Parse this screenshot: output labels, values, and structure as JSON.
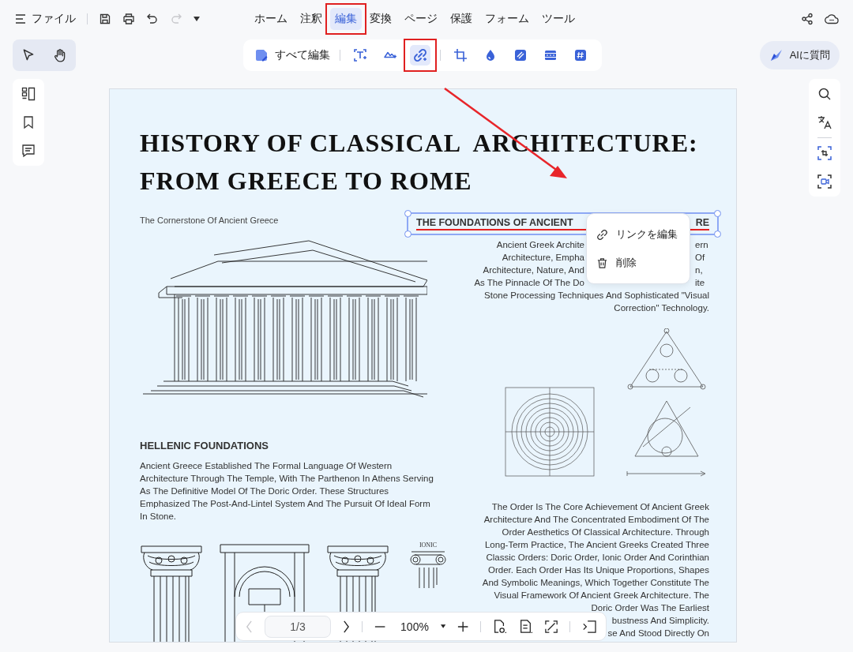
{
  "top_bar": {
    "file_menu": "ファイル",
    "redo_disabled": true
  },
  "menu_tabs": [
    {
      "label": "ホーム",
      "selected": false
    },
    {
      "label": "注釈",
      "selected": false
    },
    {
      "label": "編集",
      "selected": true
    },
    {
      "label": "変換",
      "selected": false
    },
    {
      "label": "ページ",
      "selected": false
    },
    {
      "label": "保護",
      "selected": false
    },
    {
      "label": "フォーム",
      "selected": false
    },
    {
      "label": "ツール",
      "selected": false
    }
  ],
  "edit_toolbar": {
    "edit_all": "すべて編集",
    "tools": [
      {
        "kind": "text",
        "selected": false
      },
      {
        "kind": "image",
        "selected": false
      },
      {
        "kind": "link",
        "selected": true
      },
      {
        "kind": "crop",
        "selected": false
      },
      {
        "kind": "watermark",
        "selected": false
      },
      {
        "kind": "background",
        "selected": false
      },
      {
        "kind": "header-footer",
        "selected": false
      },
      {
        "kind": "bates",
        "selected": false
      }
    ]
  },
  "ai_button": "AIに質問",
  "document": {
    "title_lines": [
      "HISTORY OF CLASSICAL  ARCHITECTURE:",
      "FROM GREECE TO ROME"
    ],
    "subtitle": "The Cornerstone Of Ancient Greece",
    "link_heading": {
      "parts": [
        "THE FOUNDATIONS OF ANCIENT",
        "RE"
      ],
      "selected": true
    },
    "intro_lines": [
      {
        "left": "Ancient Greek Archite",
        "right": "ern"
      },
      {
        "left": "Architecture, Empha",
        "right": "Of"
      },
      {
        "left": "Architecture, Nature, And",
        "right": "n,"
      },
      {
        "left": "As The Pinnacle Of The Do",
        "right": "ite"
      },
      {
        "left": "Stone Processing Techniques And Sophisticated \"Visual"
      },
      {
        "left": "Correction\" Technology."
      }
    ],
    "section_heading": "HELLENIC FOUNDATIONS",
    "section_paragraph": "Ancient Greece Established The Formal Language Of Western Architecture Through The Temple, With The Parthenon In Athens Serving As The Definitive Model Of The Doric Order. These Structures Emphasized The Post-And-Lintel System And The Pursuit Of Ideal Form In Stone.",
    "ionic_label": "IONIC",
    "orders_paragraph": "The Order Is The Core Achievement Of Ancient Greek Architecture And The Concentrated Embodiment Of The Order Aesthetics Of Classical Architecture. Through Long-Term Practice, The Ancient Greeks Created Three Classic Orders: Doric Order, Ionic Order And Corinthian Order. Each Order Has Its Unique Proportions, Shapes And Symbolic Meanings, Which Together Constitute The Visual Framework Of Ancient Greek Architecture. The Doric Order Was The Earliest",
    "orders_fragments": [
      "bustness And Simplicity.",
      "se And Stood Directly On"
    ]
  },
  "context_menu": [
    {
      "kind": "edit-link",
      "label": "リンクを編集"
    },
    {
      "kind": "delete",
      "label": "削除"
    }
  ],
  "bottom_bar": {
    "prev_disabled": true,
    "page": "1/3",
    "zoom": "100%"
  }
}
